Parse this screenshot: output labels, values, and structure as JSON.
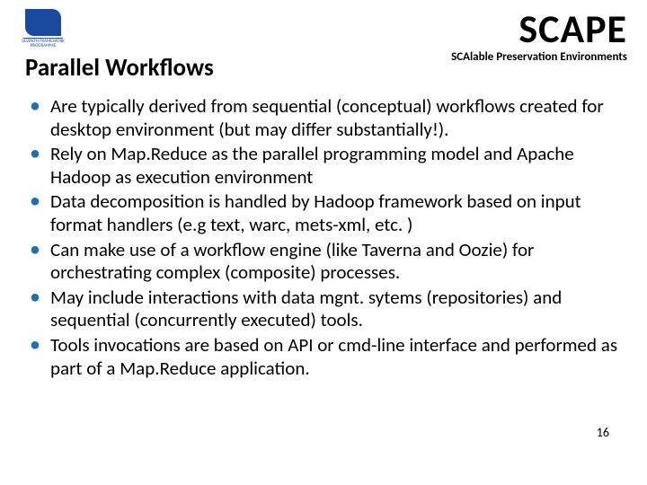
{
  "header": {
    "logo_seven": "7",
    "logo_sub": "SEVENTH FRAMEWORK PROGRAMME",
    "brand_main": "SCAPE",
    "brand_sub": "SCAlable Preservation Environments"
  },
  "title": "Parallel Workflows",
  "bullets": [
    "Are typically derived from sequential (conceptual) workflows created for desktop environment (but may differ substantially!).",
    "Rely on Map.Reduce as the parallel programming model and Apache Hadoop as execution environment",
    "Data decomposition is handled by Hadoop framework based on input format handlers (e.g text, warc, mets-xml, etc. )",
    "Can make use of a workflow engine (like Taverna and Oozie) for orchestrating complex (composite) processes.",
    "May include interactions with data mgnt. sytems (repositories) and sequential (concurrently executed) tools.",
    "Tools invocations are based on API or cmd-line interface  and performed as part of a Map.Reduce application."
  ],
  "page_number": "16"
}
